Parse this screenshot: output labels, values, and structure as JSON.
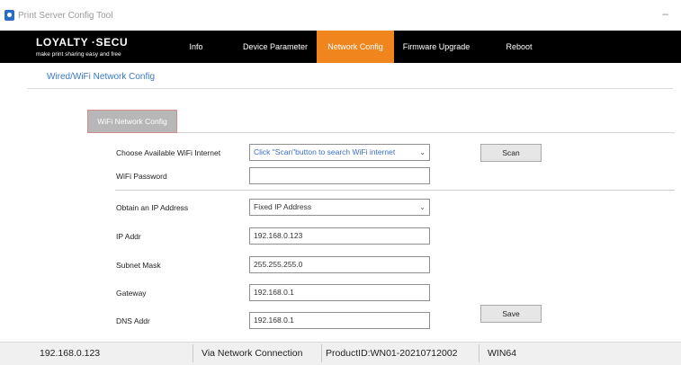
{
  "window": {
    "title": "Print Server Config Tool",
    "minimize_glyph": "–",
    "icon": "app-icon"
  },
  "brand": {
    "name": "LOYALTY ·SECU",
    "tagline": "make print sharing easy and free"
  },
  "nav": {
    "items": [
      {
        "label": "Info",
        "active": false
      },
      {
        "label": "Device Parameter",
        "active": false
      },
      {
        "label": "Network Config",
        "active": true
      },
      {
        "label": "Firmware Upgrade",
        "active": false
      },
      {
        "label": "Reboot",
        "active": false
      }
    ],
    "active_color": "#f0851d"
  },
  "subtab": {
    "label": "Wired/WiFi Network Config"
  },
  "panel": {
    "tab_label": "WiFi Network Config"
  },
  "form": {
    "wifi": {
      "label": "Choose Available WiFi Internet",
      "value": "Click \"Scan\"button to search WiFi internet"
    },
    "password": {
      "label": "WiFi Password",
      "value": ""
    },
    "obtain_ip": {
      "label": "Obtain an IP Address",
      "value": "Fixed IP Address"
    },
    "ip_addr": {
      "label": "IP Addr",
      "value": "192.168.0.123"
    },
    "subnet_mask": {
      "label": "Subnet Mask",
      "value": "255.255.255.0"
    },
    "gateway": {
      "label": "Gateway",
      "value": "192.168.0.1"
    },
    "dns_addr": {
      "label": "DNS Addr",
      "value": "192.168.0.1"
    }
  },
  "buttons": {
    "scan": "Scan",
    "save": "Save"
  },
  "status": {
    "ip": "192.168.0.123",
    "connection": "Via Network Connection",
    "product_id": "ProductID:WN01-20210712002",
    "platform": "WIN64"
  }
}
